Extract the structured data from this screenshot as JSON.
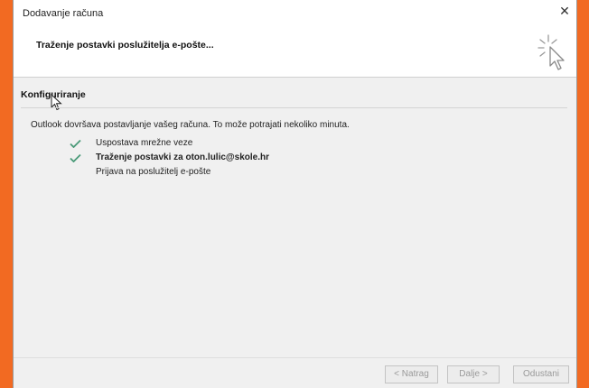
{
  "window": {
    "title": "Dodavanje računa",
    "close_label": "✕"
  },
  "header": {
    "heading": "Traženje postavki poslužitelja e-pošte..."
  },
  "section": {
    "title": "Konfiguriranje"
  },
  "content": {
    "intro": "Outlook dovršava postavljanje vašeg računa. To može potrajati nekoliko minuta.",
    "steps": [
      {
        "label": "Uspostava mrežne veze",
        "done": true,
        "bold": false
      },
      {
        "label": "Traženje postavki za oton.lulic@skole.hr",
        "done": true,
        "bold": true
      },
      {
        "label": "Prijava na poslužitelj e-pošte",
        "done": false,
        "bold": false
      }
    ]
  },
  "buttons": {
    "back": "< Natrag",
    "next": "Dalje >",
    "cancel": "Odustani"
  },
  "colors": {
    "background": "#f26a22",
    "check": "#4a9a78",
    "disabled_text": "#9a9a9a"
  },
  "icons": {
    "header": "sparkle-cursor-icon",
    "check": "checkmark-icon",
    "close": "close-icon",
    "mouse": "mouse-pointer-icon"
  }
}
